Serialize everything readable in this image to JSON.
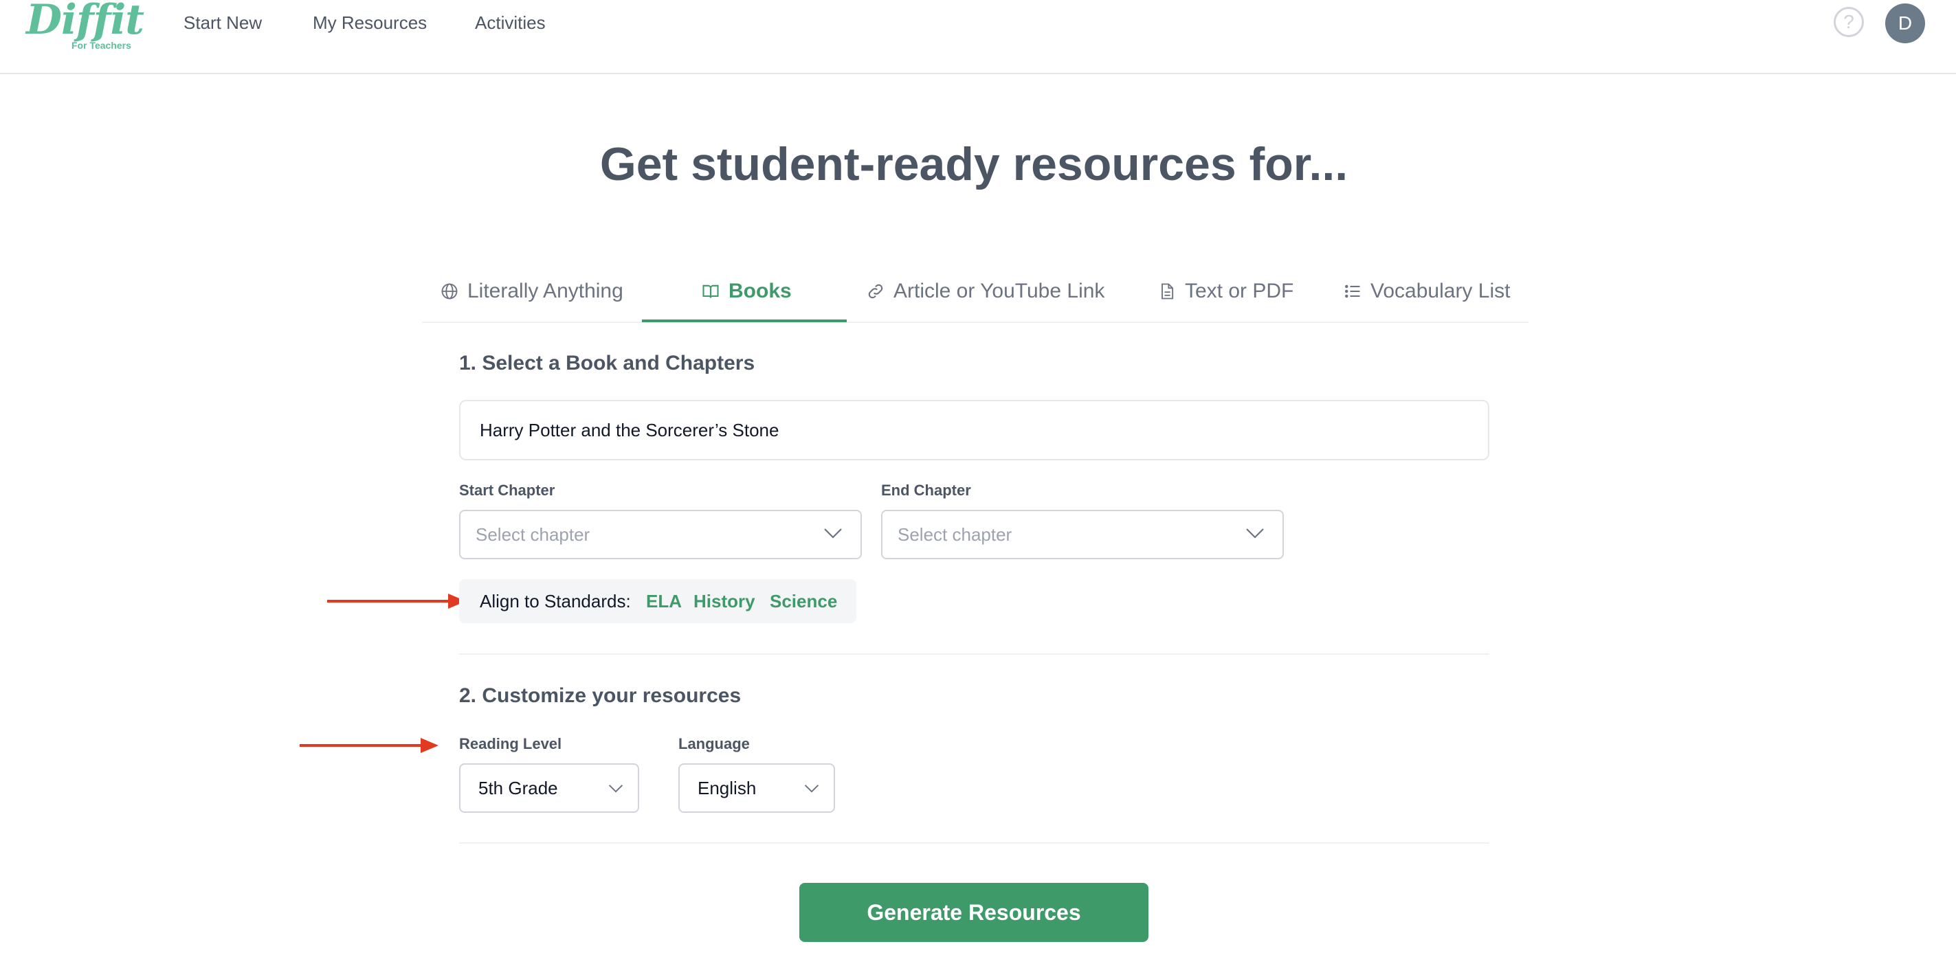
{
  "header": {
    "logo_text": "Diffit",
    "logo_sub": "For Teachers",
    "nav": [
      "Start New",
      "My Resources",
      "Activities"
    ],
    "help_symbol": "?",
    "avatar_initial": "D"
  },
  "title": "Get student-ready resources for...",
  "tabs": [
    {
      "label": "Literally Anything",
      "icon": "globe-icon"
    },
    {
      "label": "Books",
      "icon": "book-icon",
      "active": true
    },
    {
      "label": "Article or YouTube Link",
      "icon": "link-icon"
    },
    {
      "label": "Text or PDF",
      "icon": "file-icon"
    },
    {
      "label": "Vocabulary List",
      "icon": "list-icon"
    }
  ],
  "section1": {
    "title": "1. Select a Book and Chapters",
    "book_value": "Harry Potter and the Sorcerer’s Stone",
    "start_chapter_label": "Start Chapter",
    "start_chapter_placeholder": "Select chapter",
    "end_chapter_label": "End Chapter",
    "end_chapter_placeholder": "Select chapter",
    "standards_label": "Align to Standards:",
    "standards": [
      "ELA",
      "History",
      "Science"
    ]
  },
  "section2": {
    "title": "2. Customize your resources",
    "reading_level_label": "Reading Level",
    "reading_level_value": "5th Grade",
    "language_label": "Language",
    "language_value": "English"
  },
  "generate_label": "Generate Resources",
  "colors": {
    "accent": "#3f9a6a",
    "logo": "#5fbf9a",
    "annotation_arrow": "#e03a22"
  }
}
